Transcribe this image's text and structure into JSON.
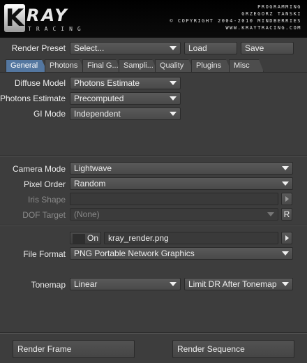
{
  "header": {
    "logo_letter": "K",
    "logo_word": "RAY",
    "logo_sub": "TRACING",
    "credit_role": "PROGRAMMING",
    "credit_name": "GRZEGORZ TANSKI",
    "copyright": "© COPYRIGHT 2004-2010 MINDBERRIES",
    "website": "WWW.KRAYTRACING.COM"
  },
  "preset": {
    "label": "Render Preset",
    "value": "Select...",
    "load_label": "Load",
    "save_label": "Save"
  },
  "tabs": [
    "General",
    "Photons",
    "Final G...",
    "Sampli...",
    "Quality",
    "Plugins",
    "Misc"
  ],
  "general": {
    "diffuse_model_label": "Diffuse Model",
    "diffuse_model_value": "Photons Estimate",
    "photons_estimate_label": "Photons Estimate",
    "photons_estimate_value": "Precomputed",
    "gi_mode_label": "GI Mode",
    "gi_mode_value": "Independent"
  },
  "camera": {
    "camera_mode_label": "Camera Mode",
    "camera_mode_value": "Lightwave",
    "pixel_order_label": "Pixel Order",
    "pixel_order_value": "Random",
    "iris_shape_label": "Iris Shape",
    "iris_shape_value": "",
    "dof_target_label": "DOF Target",
    "dof_target_value": "(None)",
    "dof_r_label": "R"
  },
  "output": {
    "on_label": "On",
    "filename": "kray_render.png",
    "file_format_label": "File Format",
    "file_format_value": "PNG Portable Network Graphics",
    "tonemap_label": "Tonemap",
    "tonemap_value": "Linear",
    "tonemap_option_value": "Limit DR After Tonemap"
  },
  "actions": {
    "render_frame_label": "Render Frame",
    "render_sequence_label": "Render Sequence"
  }
}
